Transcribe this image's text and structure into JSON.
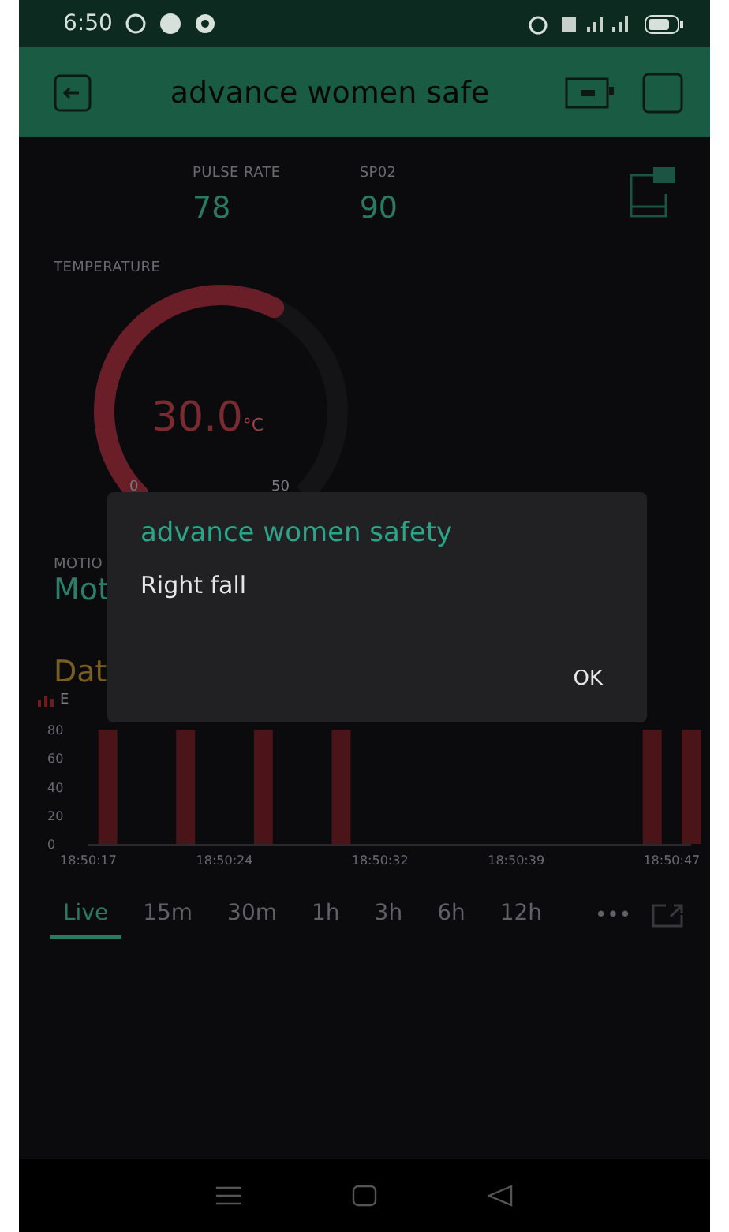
{
  "status_bar": {
    "time": "6:50"
  },
  "app_bar": {
    "title": "advance women safe"
  },
  "pulse": {
    "label": "PULSE RATE",
    "value": "78"
  },
  "spo2": {
    "label": "SP02",
    "value": "90"
  },
  "temperature": {
    "label": "TEMPERATURE",
    "value": "30.0",
    "unit": "°C",
    "min": "0",
    "max": "50"
  },
  "motion": {
    "label": "MOTIO",
    "value": "Mot"
  },
  "chart": {
    "title": "Dat",
    "chart_data": {
      "type": "bar",
      "x": [
        67818,
        67822,
        67826,
        67830,
        67846,
        67848
      ],
      "series": [
        {
          "name": "E",
          "color": "#4a1419",
          "values": [
            80,
            80,
            80,
            80,
            80,
            80
          ]
        }
      ],
      "yticks": [
        0,
        20,
        40,
        60,
        80
      ],
      "xticks": [
        {
          "value": 67817,
          "label": "18:50:17"
        },
        {
          "value": 67824,
          "label": "18:50:24"
        },
        {
          "value": 67832,
          "label": "18:50:32"
        },
        {
          "value": 67839,
          "label": "18:50:39"
        },
        {
          "value": 67847,
          "label": "18:50:47"
        }
      ],
      "xlim": [
        67817,
        67848
      ],
      "ylim": [
        0,
        84
      ]
    }
  },
  "ranges": [
    {
      "label": "Live",
      "selected": true
    },
    {
      "label": "15m",
      "selected": false
    },
    {
      "label": "30m",
      "selected": false
    },
    {
      "label": "1h",
      "selected": false
    },
    {
      "label": "3h",
      "selected": false
    },
    {
      "label": "6h",
      "selected": false
    },
    {
      "label": "12h",
      "selected": false
    }
  ],
  "more": "•••",
  "dialog": {
    "title": "advance women safety",
    "message": "Right fall",
    "button": "OK"
  }
}
